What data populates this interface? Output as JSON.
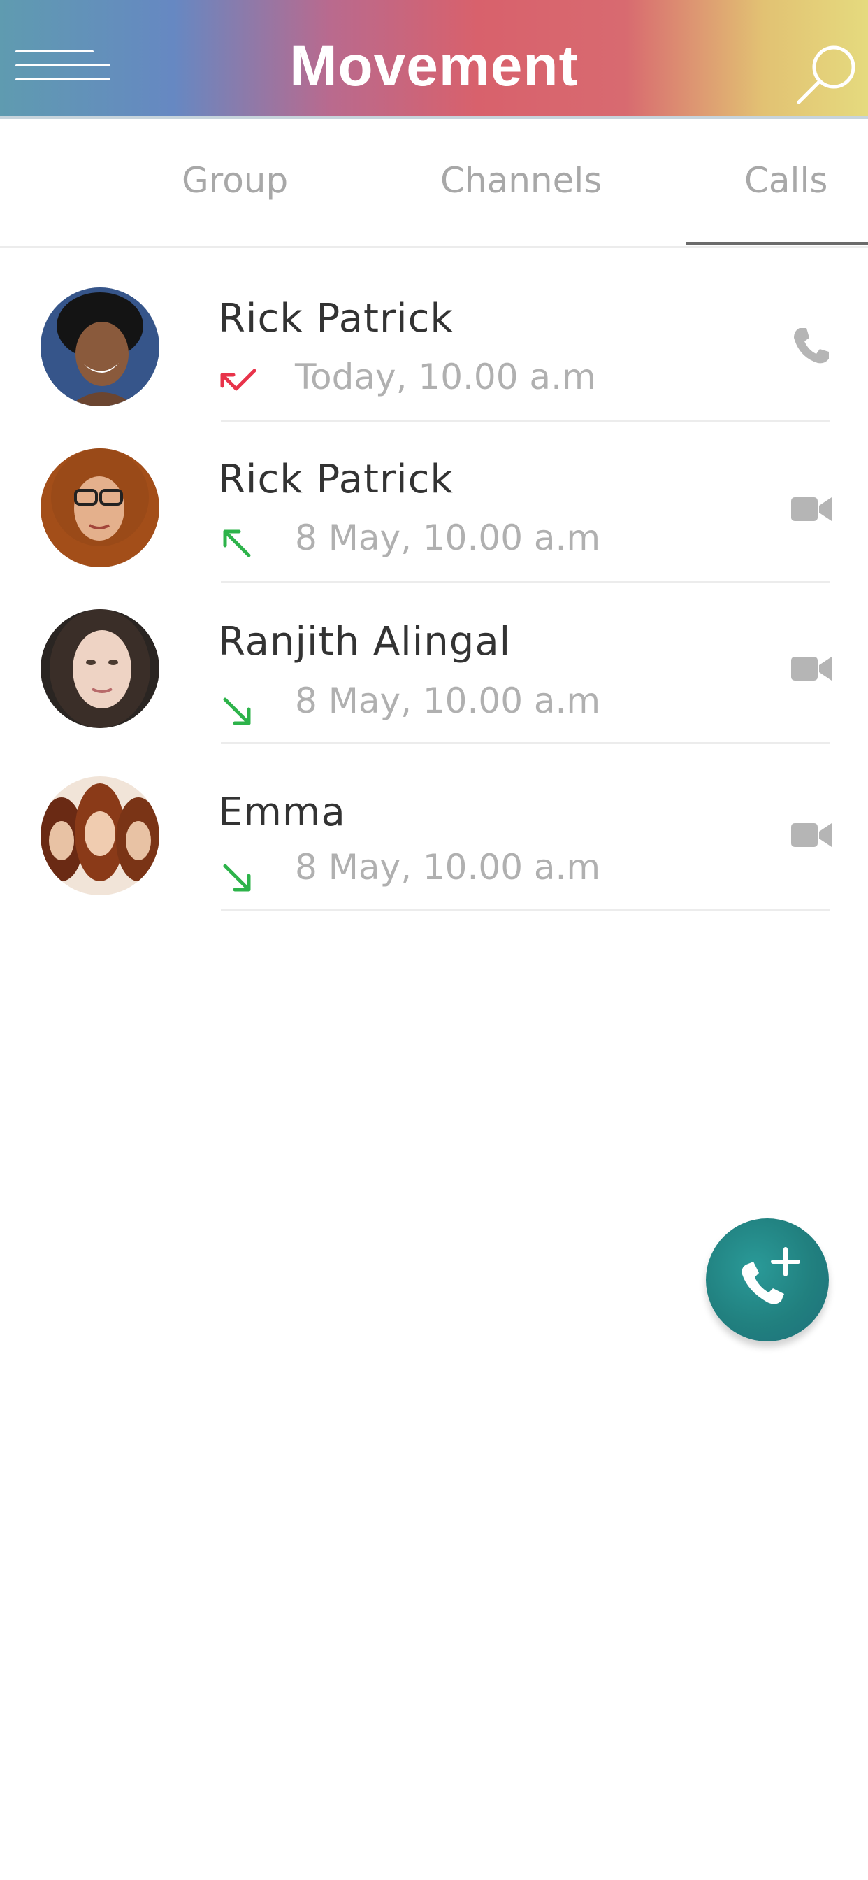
{
  "header": {
    "title": "Movement",
    "menu_icon": "hamburger-icon",
    "search_icon": "search-icon",
    "gradient_colors": [
      "#5f9bb0",
      "#6688c2",
      "#d8616c",
      "#e5da7e"
    ]
  },
  "tabs": [
    {
      "label": "Group",
      "active": false
    },
    {
      "label": "Channels",
      "active": false
    },
    {
      "label": "Calls",
      "active": true
    }
  ],
  "calls": [
    {
      "name": "Rick Patrick",
      "time": "Today, 10.00 a.m",
      "direction": "missed",
      "direction_icon": "missed-call-arrow-icon",
      "type": "voice",
      "type_icon": "phone-icon"
    },
    {
      "name": "Rick Patrick",
      "time": "8 May, 10.00 a.m",
      "direction": "outgoing",
      "direction_icon": "outgoing-arrow-icon",
      "type": "video",
      "type_icon": "video-camera-icon"
    },
    {
      "name": "Ranjith Alingal",
      "time": "8 May, 10.00 a.m",
      "direction": "incoming",
      "direction_icon": "incoming-arrow-icon",
      "type": "video",
      "type_icon": "video-camera-icon"
    },
    {
      "name": "Emma",
      "time": "8 May, 10.00 a.m",
      "direction": "incoming",
      "direction_icon": "incoming-arrow-icon",
      "type": "video",
      "type_icon": "video-camera-icon"
    }
  ],
  "fab": {
    "icon": "add-call-icon",
    "color": "#21807f"
  },
  "colors": {
    "missed": "#e8334a",
    "answered": "#2db34a",
    "icon_gray": "#b5b5b5"
  }
}
